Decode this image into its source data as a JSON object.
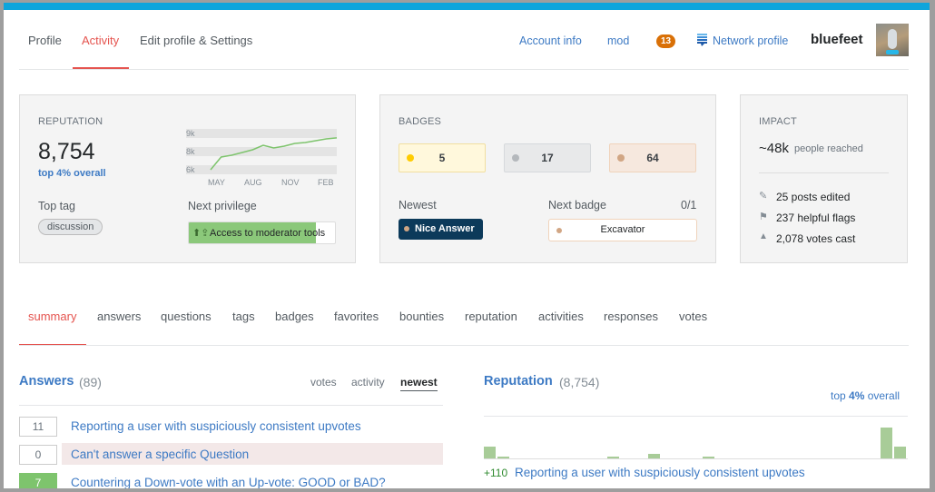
{
  "top_tabs": [
    {
      "label": "Profile",
      "active": false
    },
    {
      "label": "Activity",
      "active": true
    },
    {
      "label": "Edit profile & Settings",
      "active": false
    }
  ],
  "header": {
    "account_info": "Account info",
    "mod": "mod",
    "notification_count": "13",
    "network_profile": "Network profile",
    "username": "bluefeet"
  },
  "reputation": {
    "label": "REPUTATION",
    "value": "8,754",
    "rank": "top 4% overall",
    "top_tag_label": "Top tag",
    "top_tag": "discussion",
    "next_privilege_label": "Next privilege",
    "next_privilege": "Access to moderator tools",
    "privilege_progress": 0.87,
    "chart": {
      "y_ticks": [
        "9k",
        "8k",
        "6k"
      ],
      "x_ticks": [
        "MAY",
        "AUG",
        "NOV",
        "FEB"
      ],
      "points": [
        6000,
        7400,
        7600,
        7900,
        8100,
        8350,
        8200,
        8300,
        8450,
        8500,
        8600,
        8700,
        8754
      ]
    }
  },
  "badges": {
    "label": "BADGES",
    "gold": "5",
    "silver": "17",
    "bronze": "64",
    "newest_label": "Newest",
    "newest": "Nice Answer",
    "next_badge_label": "Next badge",
    "next_badge_progress": "0/1",
    "next_badge": "Excavator",
    "colors": {
      "gold": "#ffcc01",
      "silver": "#b4b8bc",
      "bronze": "#d1a684"
    }
  },
  "impact": {
    "label": "IMPACT",
    "reach": "~48k",
    "reach_label": "people reached",
    "stats": [
      "25 posts edited",
      "237 helpful flags",
      "2,078 votes cast"
    ]
  },
  "profile_tabs": [
    {
      "label": "summary",
      "active": true
    },
    {
      "label": "answers"
    },
    {
      "label": "questions"
    },
    {
      "label": "tags"
    },
    {
      "label": "badges"
    },
    {
      "label": "favorites"
    },
    {
      "label": "bounties"
    },
    {
      "label": "reputation"
    },
    {
      "label": "activities"
    },
    {
      "label": "responses"
    },
    {
      "label": "votes"
    }
  ],
  "answers": {
    "title": "Answers",
    "count": "(89)",
    "sort": [
      "votes",
      "activity",
      "newest"
    ],
    "active_sort": "newest",
    "items": [
      {
        "score": "11",
        "title": "Reporting a user with suspiciously consistent upvotes",
        "accepted": false,
        "highlight": false
      },
      {
        "score": "0",
        "title": "Can't answer a specific Question",
        "accepted": false,
        "highlight": true
      },
      {
        "score": "7",
        "title": "Countering a Down-vote with an Up-vote: GOOD or BAD?",
        "accepted": true,
        "highlight": false
      }
    ]
  },
  "rep_panel": {
    "title": "Reputation",
    "count": "(8,754)",
    "rank_prefix": "top ",
    "rank_pct": "4%",
    "rank_suffix": " overall",
    "bars": [
      13,
      2,
      0,
      0,
      0,
      0,
      0,
      0,
      0,
      2,
      0,
      0,
      5,
      0,
      0,
      0,
      2,
      0,
      0,
      0,
      0,
      0,
      0,
      0,
      0,
      0,
      0,
      0,
      0,
      34,
      13
    ],
    "items": [
      {
        "delta": "+110",
        "title": "Reporting a user with suspiciously consistent upvotes"
      }
    ]
  }
}
